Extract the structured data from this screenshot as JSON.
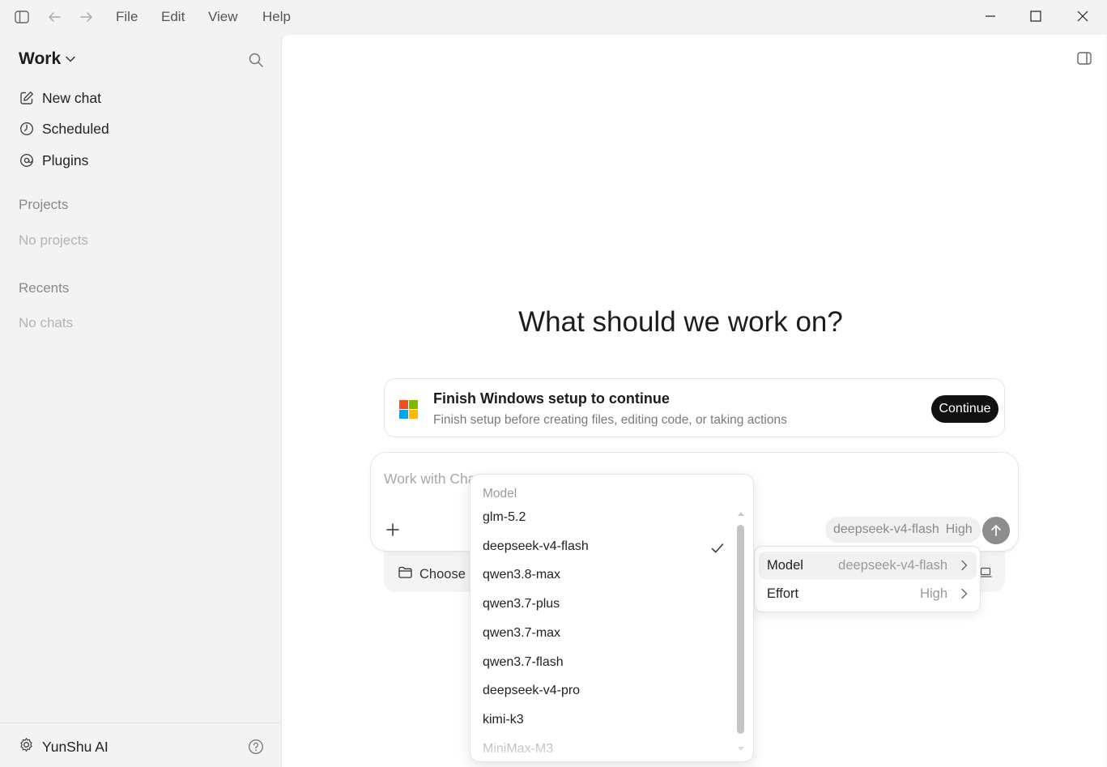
{
  "titlebar": {
    "menu": [
      "File",
      "Edit",
      "View",
      "Help"
    ],
    "icons": [
      "sidebar-toggle-icon",
      "back-arrow-icon",
      "forward-arrow-icon",
      "minimize-icon",
      "maximize-icon",
      "close-icon"
    ]
  },
  "sidebar": {
    "workspace": "Work",
    "nav": [
      {
        "label": "New chat",
        "icon": "edit-icon"
      },
      {
        "label": "Scheduled",
        "icon": "clock-icon"
      },
      {
        "label": "Plugins",
        "icon": "at-icon"
      }
    ],
    "projects_heading": "Projects",
    "projects_empty": "No projects",
    "recents_heading": "Recents",
    "recents_empty": "No chats",
    "footer_user": "YunShu AI"
  },
  "main": {
    "headline": "What should we work on?",
    "setup_card": {
      "title": "Finish Windows setup to continue",
      "subtitle": "Finish setup before creating files, editing code, or taking actions",
      "button": "Continue"
    },
    "composer": {
      "placeholder": "Work with ChatGPT",
      "model_pill": {
        "model": "deepseek-v4-flash",
        "effort": "High"
      }
    },
    "folder_label": "Choose"
  },
  "model_dropdown": {
    "header": "Model",
    "items": [
      "glm-5.2",
      "deepseek-v4-flash",
      "qwen3.8-max",
      "qwen3.7-plus",
      "qwen3.7-max",
      "qwen3.7-flash",
      "deepseek-v4-pro",
      "kimi-k3",
      "MiniMax-M3"
    ],
    "selected": "deepseek-v4-flash"
  },
  "settings_menu": {
    "rows": [
      {
        "label": "Model",
        "value": "deepseek-v4-flash"
      },
      {
        "label": "Effort",
        "value": "High"
      }
    ]
  },
  "colors": {
    "accent_dark": "#111111",
    "send_button": "#8d8d8d",
    "ms_red": "#f25022",
    "ms_green": "#7fba00",
    "ms_blue": "#00a4ef",
    "ms_yellow": "#ffb900"
  }
}
